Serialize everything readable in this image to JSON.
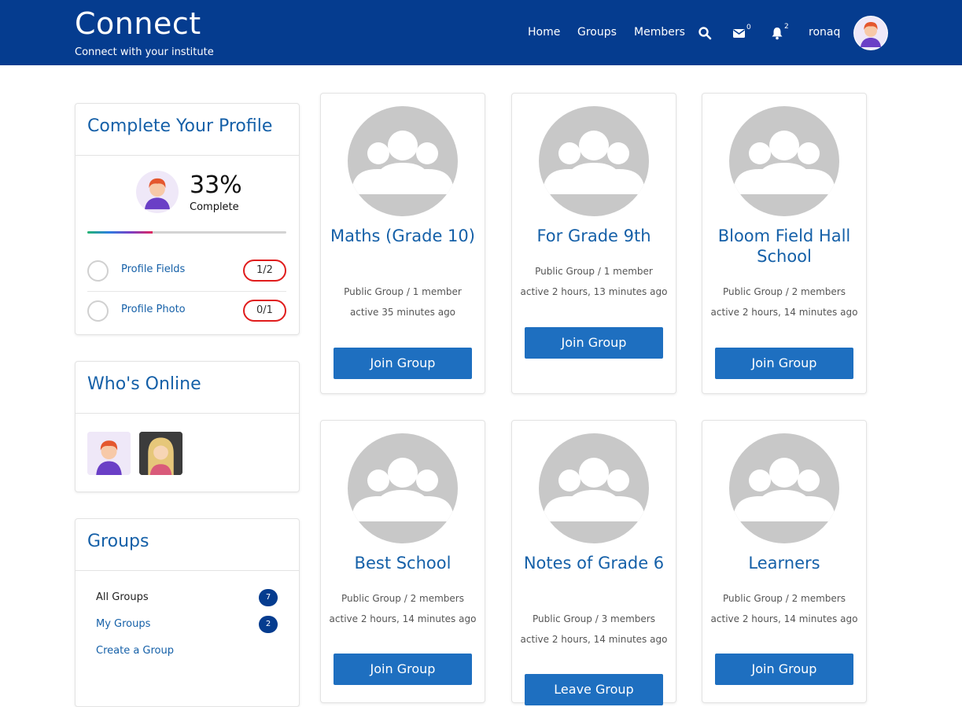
{
  "header": {
    "brand": "Connect",
    "tagline": "Connect with your institute",
    "nav": [
      "Home",
      "Groups",
      "Members"
    ],
    "messages_count": "0",
    "notifications_count": "2",
    "username": "ronaq"
  },
  "profile_complete": {
    "title": "Complete Your Profile",
    "percent": "33%",
    "percent_value": 33,
    "complete_label": "Complete",
    "rows": [
      {
        "label": "Profile Fields",
        "progress": "1/2"
      },
      {
        "label": "Profile Photo",
        "progress": "0/1"
      }
    ]
  },
  "whos_online": {
    "title": "Who's Online"
  },
  "groups_widget": {
    "title": "Groups",
    "items": [
      {
        "label": "All Groups",
        "count": "7"
      },
      {
        "label": "My Groups",
        "count": "2"
      },
      {
        "label": "Create a Group"
      }
    ]
  },
  "groups": [
    {
      "name": "Maths (Grade 10)",
      "type": "Public Group / 1 member",
      "active": "active 35 minutes ago",
      "button": "Join Group"
    },
    {
      "name": "For Grade 9th",
      "type": "Public Group / 1 member",
      "active": "active 2 hours, 13 minutes ago",
      "button": "Join Group"
    },
    {
      "name": "Bloom Field Hall School",
      "type": "Public Group / 2 members",
      "active": "active 2 hours, 14 minutes ago",
      "button": "Join Group"
    },
    {
      "name": "Best School",
      "type": "Public Group / 2 members",
      "active": "active 2 hours, 14 minutes ago",
      "button": "Join Group"
    },
    {
      "name": "Notes of Grade 6",
      "type": "Public Group / 3 members",
      "active": "active 2 hours, 14 minutes ago",
      "button": "Leave Group"
    },
    {
      "name": "Learners",
      "type": "Public Group / 2 members",
      "active": "active 2 hours, 14 minutes ago",
      "button": "Join Group"
    }
  ],
  "colors": {
    "header_bg": "#053c8f",
    "accent_text": "#1560a8",
    "button_bg": "#1e6fc0",
    "pill_border": "#e01c1c"
  }
}
